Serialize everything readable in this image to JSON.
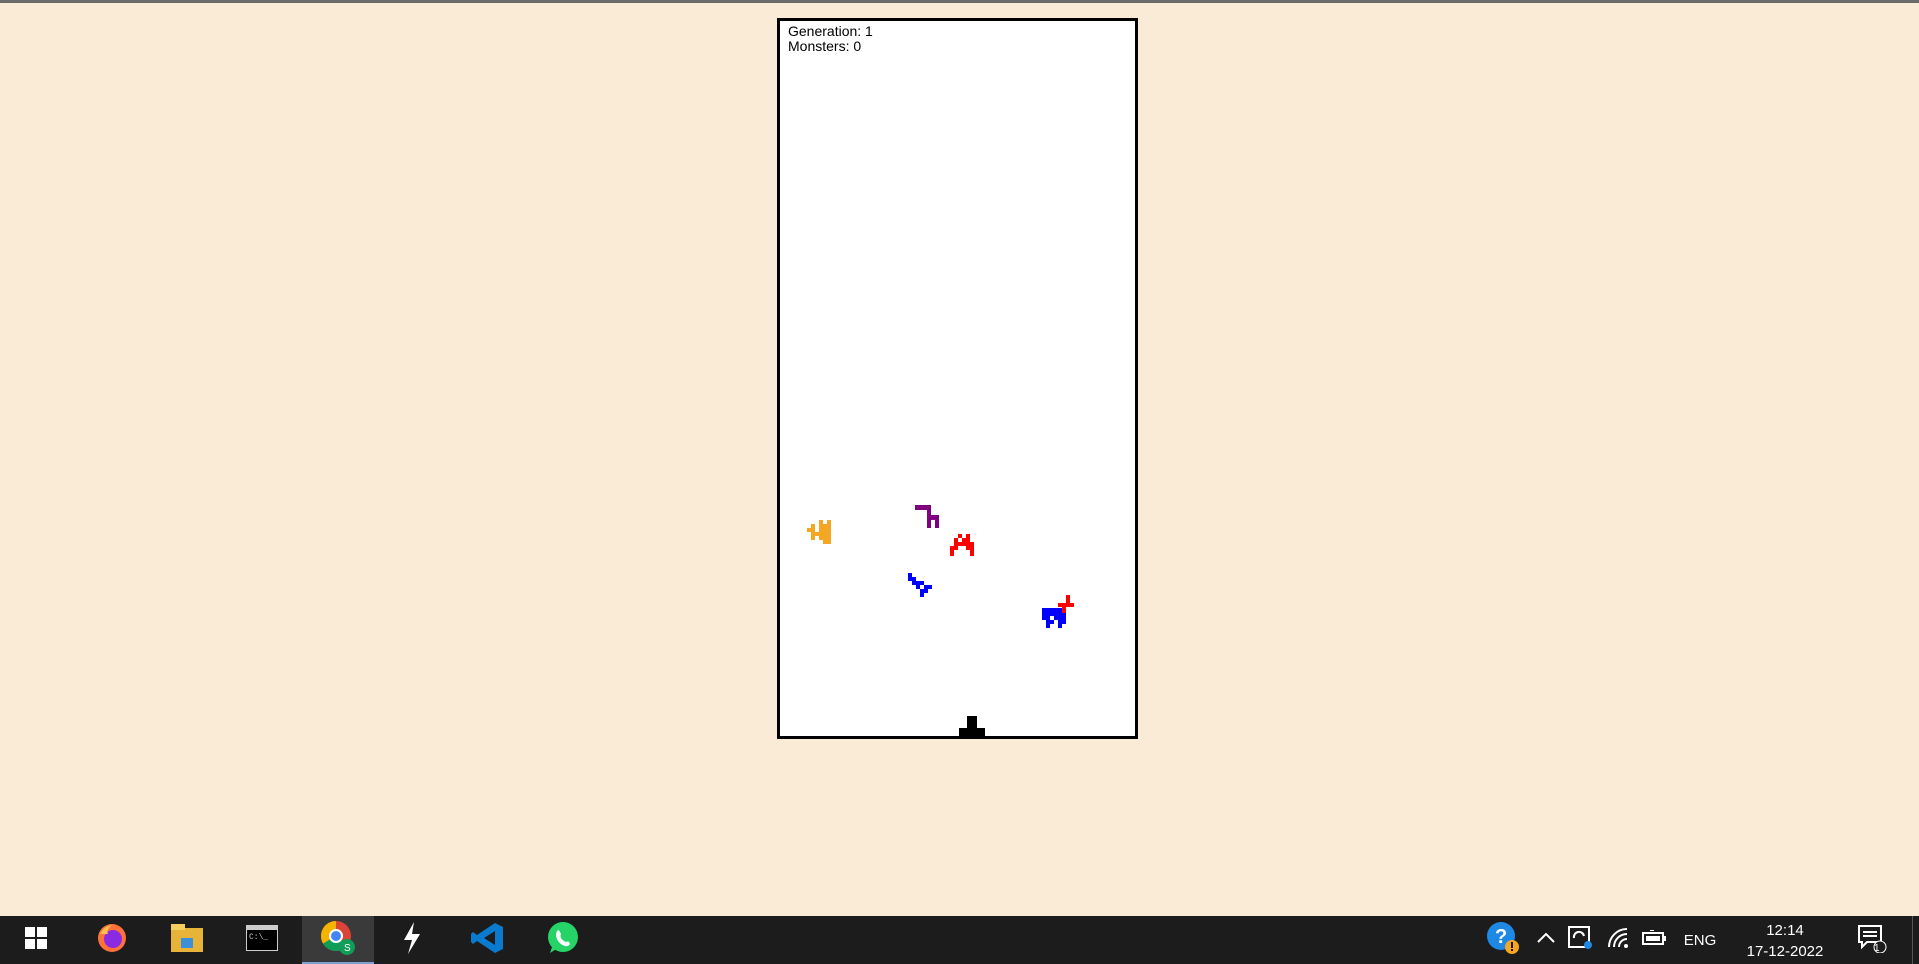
{
  "hud": {
    "generation_label": "Generation: 1",
    "monsters_label": "Monsters: 0"
  },
  "monsters": [
    {
      "name": "monster-orange",
      "color": "#f5a623"
    },
    {
      "name": "monster-purple",
      "color": "#800080"
    },
    {
      "name": "monster-red",
      "color": "#ff0000"
    },
    {
      "name": "monster-blue",
      "color": "#0000ff"
    },
    {
      "name": "monster-blue-large",
      "color": "#0000ff"
    },
    {
      "name": "monster-red-small",
      "color": "#ff0000"
    }
  ],
  "player": {
    "name": "player-cannon",
    "color": "#000000"
  },
  "taskbar": {
    "apps": [
      {
        "name": "start-button-icon"
      },
      {
        "name": "firefox-icon"
      },
      {
        "name": "file-explorer-icon"
      },
      {
        "name": "terminal-icon"
      },
      {
        "name": "chrome-icon",
        "active": true
      },
      {
        "name": "app-icon"
      },
      {
        "name": "vscode-icon"
      },
      {
        "name": "whatsapp-icon"
      }
    ],
    "tray": {
      "language": "ENG",
      "time": "12:14",
      "date": "17-12-2022",
      "notification_count": "1"
    }
  }
}
